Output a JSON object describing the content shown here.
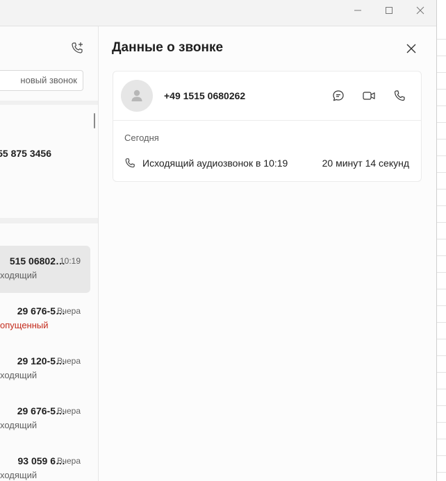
{
  "window": {
    "controls": {
      "minimize_icon": "minimize-icon",
      "maximize_icon": "maximize-icon",
      "close_icon": "close-icon"
    }
  },
  "left_panel": {
    "new_call_icon": "phone-plus-icon",
    "search_placeholder": "новый звонок",
    "dialpad_number": "55 875 3456",
    "recent_calls": [
      {
        "name": "515 06802…",
        "time": "10:19",
        "status": "ходящий",
        "missed": false,
        "selected": true
      },
      {
        "name": "29 676-5…",
        "time": "Вчера",
        "status": "опущенный",
        "missed": true,
        "selected": false
      },
      {
        "name": "29 120-5…",
        "time": "Вчера",
        "status": "ходящий",
        "missed": false,
        "selected": false
      },
      {
        "name": "29 676-5…",
        "time": "Вчера",
        "status": "ходящий",
        "missed": false,
        "selected": false
      },
      {
        "name": "93 059 6…",
        "time": "Вчера",
        "status": "ходящий",
        "missed": false,
        "selected": false
      }
    ]
  },
  "details": {
    "title": "Данные о звонке",
    "contact_number": "+49 1515 0680262",
    "actions": [
      "chat-icon",
      "video-icon",
      "phone-icon"
    ],
    "date_header": "Сегодня",
    "log": {
      "description": "Исходящий аудиозвонок в 10:19",
      "duration": "20 минут 14 секунд"
    }
  },
  "colors": {
    "missed": "#c42b1c",
    "selected_bg": "#e8e8e8",
    "panel_bg": "#fcfcfc"
  }
}
